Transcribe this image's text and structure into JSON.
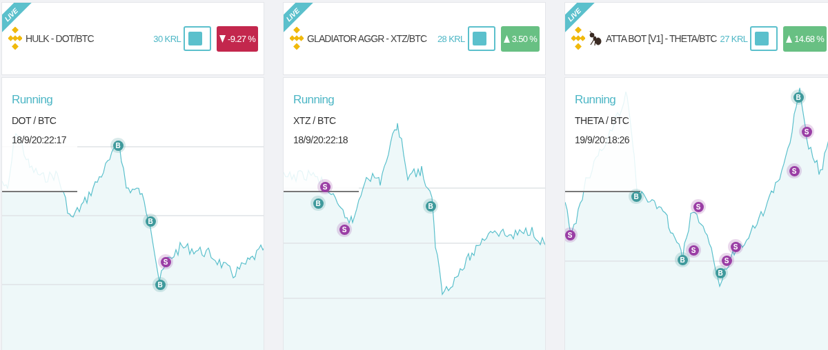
{
  "cards": [
    {
      "badge": "LIVE",
      "title": "HULK - DOT/BTC",
      "ant_icon": false,
      "price": "30 KRL",
      "on": false,
      "change": {
        "up": false,
        "text": "-9.27 %"
      },
      "status": "Running",
      "pair": "DOT / BTC",
      "time": "18/9/20:22:17",
      "markers": [
        {
          "label": "B"
        },
        {
          "label": "B"
        },
        {
          "label": "S"
        },
        {
          "label": "B"
        }
      ]
    },
    {
      "badge": "LIVE",
      "title": "GLADIATOR AGGR - XTZ/BTC",
      "ant_icon": false,
      "price": "28 KRL",
      "on": false,
      "change": {
        "up": true,
        "text": "3.50 %"
      },
      "status": "Running",
      "pair": "XTZ / BTC",
      "time": "18/9/20:22:18",
      "markers": [
        {
          "label": "S"
        },
        {
          "label": "B"
        },
        {
          "label": "S"
        },
        {
          "label": "B"
        }
      ]
    },
    {
      "badge": "LIVE",
      "title": "ATTA BOT [V1] - THETA/BTC",
      "ant_icon": true,
      "price": "27 KRL",
      "on": false,
      "change": {
        "up": true,
        "text": "14.68 %"
      },
      "status": "Running",
      "pair": "THETA / BTC",
      "time": "19/9/20:18:26",
      "markers": [
        {
          "label": "S"
        },
        {
          "label": "B"
        },
        {
          "label": "S"
        },
        {
          "label": "B"
        },
        {
          "label": "S"
        },
        {
          "label": "B"
        },
        {
          "label": "S"
        },
        {
          "label": "S"
        },
        {
          "label": "B"
        },
        {
          "label": "S"
        },
        {
          "label": "S"
        }
      ]
    }
  ]
}
